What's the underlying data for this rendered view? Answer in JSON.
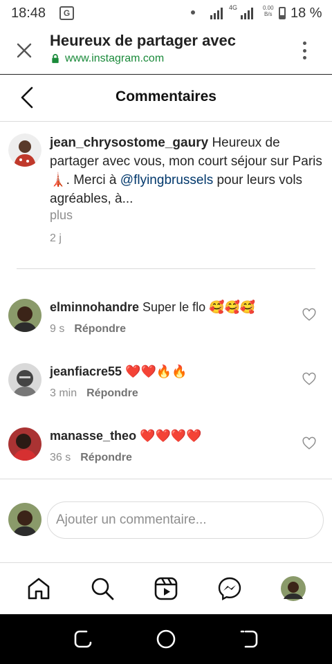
{
  "status_bar": {
    "time": "18:48",
    "translate_icon": "translate-icon",
    "network": "4G",
    "speed_value": "0.00",
    "speed_unit": "B/s",
    "battery": "18 %"
  },
  "browser": {
    "title": "Heureux de partager avec",
    "url": "www.instagram.com",
    "close_icon": "close-icon",
    "menu_icon": "more-vertical-icon",
    "secure_color": "#1a8a3a"
  },
  "page": {
    "title": "Commentaires"
  },
  "caption": {
    "username": "jean_chrysostome_gaury",
    "text_before": " Heureux de partager avec vous, mon court séjour sur Paris 🗼. Merci à ",
    "mention": "@flyingbrussels",
    "text_after": " pour leurs vols agréables, à...",
    "more": "plus",
    "age": "2 j"
  },
  "comments": [
    {
      "username": "elminnohandre",
      "text": "Super le flo 🥰🥰🥰",
      "age": "9 s",
      "reply": "Répondre"
    },
    {
      "username": "jeanfiacre55",
      "text": "❤️❤️🔥🔥",
      "age": "3 min",
      "reply": "Répondre"
    },
    {
      "username": "manasse_theo",
      "text": "❤️❤️❤️❤️",
      "age": "36 s",
      "reply": "Répondre"
    }
  ],
  "add_comment": {
    "placeholder": "Ajouter un commentaire..."
  },
  "bottom_nav": [
    "home-icon",
    "search-icon",
    "reels-icon",
    "messenger-icon",
    "profile-avatar"
  ],
  "colors": {
    "link": "#00376b",
    "muted": "#8e8e8e",
    "divider": "#dbdbdb"
  }
}
